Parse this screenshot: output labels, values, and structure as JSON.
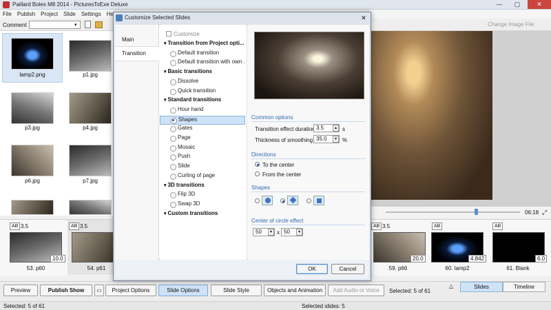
{
  "app": {
    "title": "Paillard Bolex M8 2014 - PicturesToExe Deluxe"
  },
  "menu": [
    "File",
    "Publish",
    "Project",
    "Slide",
    "Settings",
    "Help"
  ],
  "toolbar": {
    "comment_label": "Comment",
    "change_image": "Change Image File"
  },
  "browser": {
    "items": [
      {
        "label": "lamp2.png"
      },
      {
        "label": "p1.jpg"
      },
      {
        "label": "p3.jpg"
      },
      {
        "label": "p4.jpg"
      },
      {
        "label": "p6.jpg"
      },
      {
        "label": "p7.jpg"
      }
    ]
  },
  "preview": {
    "timecode": "06:18",
    "position_fraction": 0.67
  },
  "strip": {
    "slides": [
      {
        "label": "53. p60",
        "duration": "10.0",
        "ab": "AB",
        "value": "3.5"
      },
      {
        "label": "54. p61",
        "duration": "10.0",
        "ab": "AB",
        "value": "3.5"
      },
      {
        "label": "59. p66",
        "duration": "20.0",
        "ab": "AB",
        "value": "3.5"
      },
      {
        "label": "60. lamp2",
        "duration": "4.842",
        "ab": "AB"
      },
      {
        "label": "61. Blank",
        "duration": "6.0",
        "ab": "AB"
      }
    ]
  },
  "bottom": {
    "preview": "Preview",
    "publish": "Publish Show",
    "project_options": "Project Options",
    "slide_options": "Slide Options",
    "slide_style": "Slide Style",
    "objects": "Objects and Animation",
    "add_audio": "Add Audio or Voice",
    "selected": "Selected: 5 of 61",
    "tab_slides": "Slides",
    "tab_timeline": "Timeline"
  },
  "status": {
    "left": "Selected: 5 of 61",
    "center": "Selected slides: 5"
  },
  "dialog": {
    "title": "Customize Selected Slides",
    "nav": [
      "Main",
      "Transition"
    ],
    "customize": "Customize",
    "transitions": [
      {
        "type": "group",
        "label": "Transition from Project opti..."
      },
      {
        "type": "option",
        "label": "Default transition"
      },
      {
        "type": "option",
        "label": "Default transition with own ..."
      },
      {
        "type": "group",
        "label": "Basic transitions"
      },
      {
        "type": "option",
        "label": "Dissolve"
      },
      {
        "type": "option",
        "label": "Quick transition"
      },
      {
        "type": "group",
        "label": "Standard transitions"
      },
      {
        "type": "option",
        "label": "Hour hand"
      },
      {
        "type": "option",
        "label": "Shapes",
        "selected": true
      },
      {
        "type": "option",
        "label": "Gates"
      },
      {
        "type": "option",
        "label": "Page"
      },
      {
        "type": "option",
        "label": "Mosaic"
      },
      {
        "type": "option",
        "label": "Push"
      },
      {
        "type": "option",
        "label": "Slide"
      },
      {
        "type": "option",
        "label": "Curling of page"
      },
      {
        "type": "group",
        "label": "3D transitions"
      },
      {
        "type": "option",
        "label": "Flip 3D"
      },
      {
        "type": "option",
        "label": "Swap 3D"
      },
      {
        "type": "group",
        "label": "Custom transitions"
      }
    ],
    "common": {
      "heading": "Common options",
      "duration_label": "Transition effect duration",
      "duration_value": "3.5",
      "duration_unit": "s",
      "smoothing_label": "Thickness of smoothing lin",
      "smoothing_value": "35.0",
      "smoothing_unit": "%"
    },
    "directions": {
      "heading": "Directions",
      "to_center": "To the center",
      "from_center": "From the center"
    },
    "shapes": {
      "heading": "Shapes"
    },
    "center": {
      "heading": "Center of circle effect",
      "x": "50",
      "sep": "x",
      "y": "50"
    },
    "ok": "OK",
    "cancel": "Cancel"
  }
}
